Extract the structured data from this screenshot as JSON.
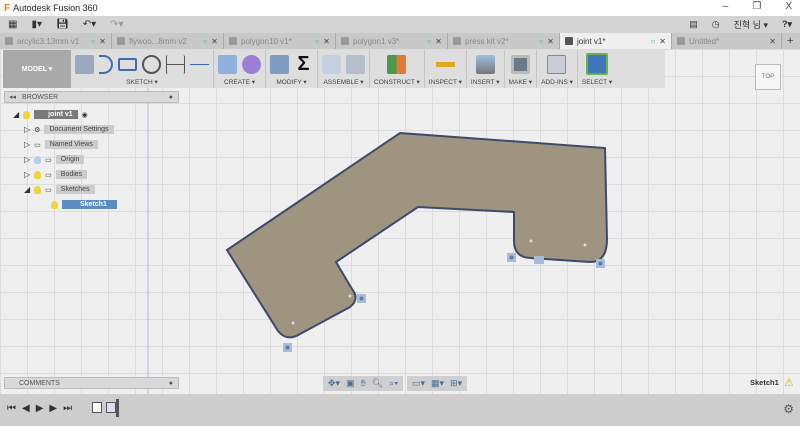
{
  "app": {
    "title": "Autodesk Fusion 360",
    "logo": "F"
  },
  "window_controls": {
    "minimize": "–",
    "restore": "❐",
    "close": "X"
  },
  "qat": {
    "user": "진혁 님 ▾",
    "help": "?▾"
  },
  "tabs": [
    {
      "label": "arcylic3.13mm v1",
      "active": false
    },
    {
      "label": "flywoo...8mm v2",
      "active": false
    },
    {
      "label": "polygon10 v1*",
      "active": false
    },
    {
      "label": "polygon1 v3*",
      "active": false
    },
    {
      "label": "press kit v2*",
      "active": false
    },
    {
      "label": "joint v1*",
      "active": true
    },
    {
      "label": "Untitled*",
      "active": false
    }
  ],
  "ribbon": {
    "workspace": "MODEL ▾",
    "groups": [
      {
        "label": "SKETCH ▾",
        "icons": [
          "create-sketch",
          "spline",
          "rectangle",
          "circle",
          "dimension",
          "construction-line"
        ]
      },
      {
        "label": "CREATE ▾",
        "icons": [
          "extrude",
          "form"
        ]
      },
      {
        "label": "MODIFY ▾",
        "icons": [
          "press-pull",
          "sum"
        ]
      },
      {
        "label": "ASSEMBLE ▾",
        "icons": [
          "new-component",
          "joint"
        ]
      },
      {
        "label": "CONSTRUCT ▾",
        "icons": [
          "offset-plane"
        ]
      },
      {
        "label": "INSPECT ▾",
        "icons": [
          "measure"
        ]
      },
      {
        "label": "INSERT ▾",
        "icons": [
          "insert-image"
        ]
      },
      {
        "label": "MAKE ▾",
        "icons": [
          "3d-print"
        ]
      },
      {
        "label": "ADD-INS ▾",
        "icons": [
          "scripts"
        ]
      },
      {
        "label": "SELECT ▾",
        "icons": [
          "select"
        ]
      }
    ]
  },
  "viewcube": {
    "face": "TOP"
  },
  "browser": {
    "title": "BROWSER",
    "root": "joint v1",
    "items": [
      "Document Settings",
      "Named Views",
      "Origin",
      "Bodies",
      "Sketches"
    ],
    "sketch": "Sketch1"
  },
  "comments": {
    "title": "COMMENTS"
  },
  "status": {
    "active_sketch": "Sketch1"
  },
  "colors": {
    "profile_fill": "#9e9480",
    "profile_stroke": "#3d4a6b",
    "selected": "#5a8cbf",
    "accent": "#e8811f"
  }
}
